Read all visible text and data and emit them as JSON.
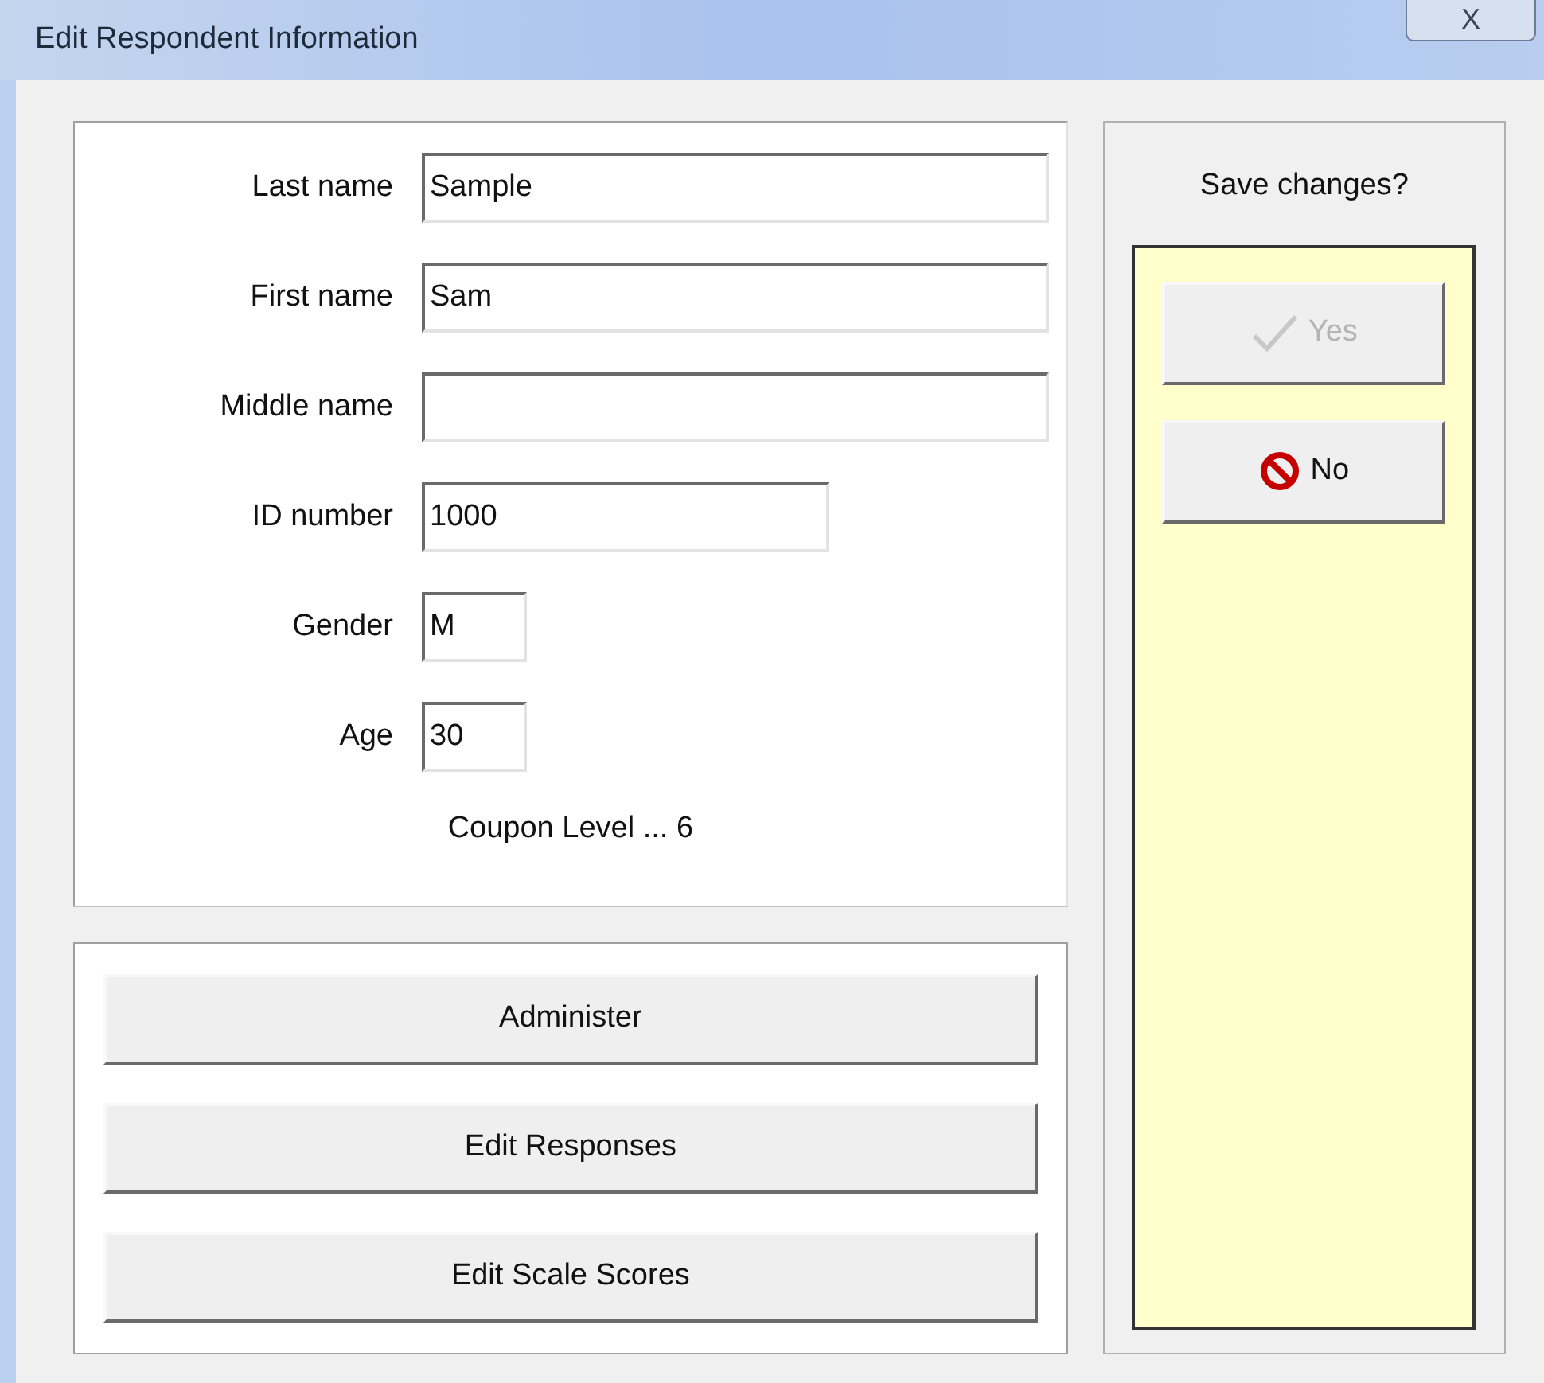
{
  "window": {
    "title": "Edit Respondent Information",
    "close_button": "X"
  },
  "fields": [
    {
      "label": "Last name",
      "value": "Sample"
    },
    {
      "label": "First name",
      "value": "Sam"
    },
    {
      "label": "Middle name"
    },
    {
      "label": "ID number",
      "value": "1000"
    },
    {
      "label": "Gender",
      "value": "M"
    },
    {
      "label": "Age",
      "value": "30"
    }
  ],
  "coupon_level": "Coupon Level ... 6",
  "actions": [
    {
      "label": "Administer"
    },
    {
      "label": "Edit Responses"
    },
    {
      "label": "Edit Scale Scores"
    }
  ],
  "save_panel": {
    "prompt": "Save changes?",
    "buttons": [
      {
        "kind": "yes",
        "label": "Yes",
        "disabled": true
      },
      {
        "kind": "no",
        "label": "No",
        "disabled": false
      }
    ]
  }
}
